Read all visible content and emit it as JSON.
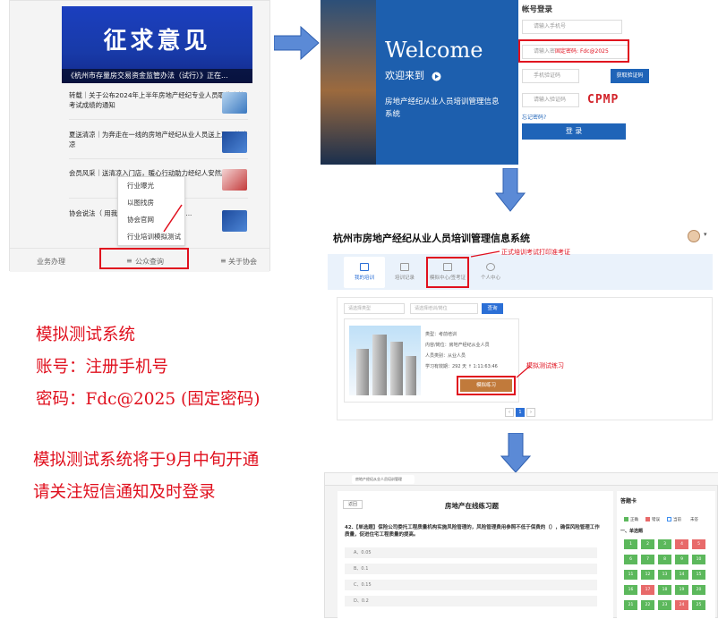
{
  "phone": {
    "banner_title": "征求意见",
    "banner_caption": "《杭州市存量房交易资金监管办法（试行）》正在...",
    "news": [
      "转载｜关于公布2024年上半年房地产经纪专业人员职业资格考试成绩的通知",
      "夏送清凉｜为奔走在一线的房地产经纪从业人员送上夏日的清凉",
      "会员风采｜送清凉入门店，暖心行动助力经纪人安然度",
      "协会说法（    用我公司房源信息成    付佣金..."
    ],
    "popup_items": [
      "行业曝光",
      "以图找房",
      "协会官网",
      "行业培训模拟测试"
    ],
    "tabs": [
      "业务办理",
      "公众查询",
      "关于协会"
    ],
    "tab_icon_mid": "≡",
    "tab_icon_right": "≡"
  },
  "login": {
    "welcome": "Welcome",
    "welcome_to": "欢迎来到",
    "system_name": "房地产经纪从业人员培训管理信息系统",
    "form_title": "帐号登录",
    "phone_placeholder": "请输入手机号",
    "password_hint_prefix": "请输入密",
    "password_hint_highlight": "固定密码: Fdc@2025",
    "sms_placeholder": "手机验证码",
    "get_code": "获取验证码",
    "captcha_placeholder": "请输入验证码",
    "captcha": "CPMP",
    "forgot": "忘记密码?",
    "login_button": "登  录"
  },
  "portal": {
    "title": "杭州市房地产经纪从业人员培训管理信息系统",
    "dropdown_icon": "▾",
    "tabs": [
      "我的培训",
      "培训记录",
      "模拟中心/签考证",
      "个人中心"
    ],
    "annot_exam": "正式培训考试打印准考证",
    "annot_practice": "模拟测试练习",
    "filter_1": "请选择类型",
    "filter_2": "请选择培训/岗位",
    "query": "查询",
    "meta": [
      "类型：考前培训",
      "内容/岗位：房地产经纪从业人员",
      "人员类别：从业人员",
      "学习有效期：292 天 ↑ 1:11:63:46"
    ],
    "practice_button": "模拟练习",
    "pages": [
      "‹",
      "1",
      "›"
    ]
  },
  "exam": {
    "browser_tab": "房地产经纪从业人员培训管理",
    "back": "返回",
    "title": "房地产在线练习题",
    "question": "42.【单选题】保险公司委托工程质量机构实施风险管理的，风险管理费用参照不低于保费的（），确保风险管理工作质量，促进住宅工程质量的提高。",
    "options": [
      "A、0.05",
      "B、0.1",
      "C、0.15",
      "D、0.2"
    ],
    "answer_card": "答题卡",
    "legend": [
      "正确",
      "错误",
      "当前",
      "未答"
    ],
    "category": "一、单选题",
    "cells": [
      "1",
      "2",
      "3",
      "4",
      "5",
      "6",
      "7",
      "8",
      "9",
      "10",
      "11",
      "12",
      "13",
      "14",
      "15",
      "16",
      "17",
      "18",
      "19",
      "20",
      "21",
      "22",
      "23",
      "24",
      "25"
    ],
    "cell_states": [
      "g",
      "g",
      "g",
      "r",
      "r",
      "g",
      "g",
      "g",
      "g",
      "g",
      "g",
      "g",
      "g",
      "g",
      "g",
      "g",
      "r",
      "g",
      "g",
      "g",
      "g",
      "g",
      "g",
      "r",
      "g"
    ],
    "colors": {
      "green": "#5cb85c",
      "red": "#e86a6a",
      "blue": "#3f8ff0"
    }
  },
  "info": {
    "line1": "模拟测试系统",
    "line2": "账号：注册手机号",
    "line3": "密码：Fdc@2025 (固定密码)",
    "notice1": "模拟测试系统将于9月中旬开通",
    "notice2": "请关注短信通知及时登录"
  },
  "colors": {
    "red": "#e0101e",
    "arrow": "#3e73c9"
  }
}
